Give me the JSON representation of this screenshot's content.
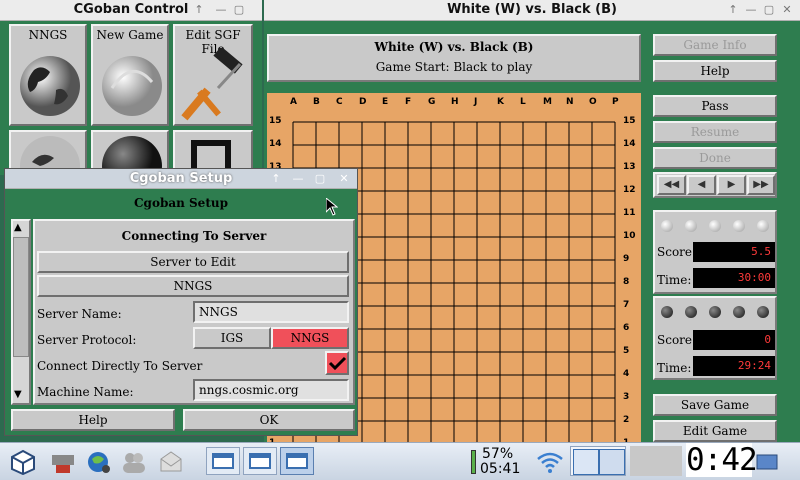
{
  "control": {
    "title": "CGoban Control",
    "buttons": [
      {
        "label": "NNGS"
      },
      {
        "label": "New Game"
      },
      {
        "label": "Edit SGF File"
      }
    ]
  },
  "game": {
    "window_title": "White (W) vs. Black (B)",
    "header_title": "White (W) vs. Black (B)",
    "status": "Game Start: Black to play",
    "col_labels": [
      "A",
      "B",
      "C",
      "D",
      "E",
      "F",
      "G",
      "H",
      "J",
      "K",
      "L",
      "M",
      "N",
      "O",
      "P"
    ],
    "row_labels": [
      "15",
      "14",
      "13",
      "12",
      "11",
      "10",
      "9",
      "8",
      "7",
      "6",
      "5",
      "4",
      "3",
      "2",
      "1"
    ],
    "buttons": {
      "game_info": "Game Info",
      "help": "Help",
      "pass": "Pass",
      "resume": "Resume",
      "done": "Done",
      "save_game": "Save Game",
      "edit_game": "Edit Game"
    },
    "nav": [
      "◀◀",
      "◀",
      "▶",
      "▶▶"
    ],
    "white": {
      "score_label": "Score:",
      "score": "5.5",
      "time_label": "Time:",
      "time": "30:00"
    },
    "black": {
      "score_label": "Score:",
      "score": "0",
      "time_label": "Time:",
      "time": "29:24"
    },
    "colors": {
      "board": "#e7a566",
      "lcd_text": "#ff3a3a",
      "felt": "#2e7d4f"
    }
  },
  "setup": {
    "window_title": "Cgoban Setup",
    "header": "Cgoban Setup",
    "section_title": "Connecting To Server",
    "server_to_edit": "Server to Edit",
    "server_selected": "NNGS",
    "server_name_label": "Server Name:",
    "server_name_value": "NNGS",
    "protocol_label": "Server Protocol:",
    "protocol_options": [
      "IGS",
      "NNGS"
    ],
    "protocol_selected": "NNGS",
    "connect_direct_label": "Connect Directly To Server",
    "connect_direct_checked": true,
    "machine_name_label": "Machine Name:",
    "machine_name_value": "nngs.cosmic.org",
    "help_button": "Help",
    "ok_button": "OK"
  },
  "taskbar": {
    "battery_percent": "57%",
    "battery_time": "05:41",
    "clock": "0:42"
  }
}
